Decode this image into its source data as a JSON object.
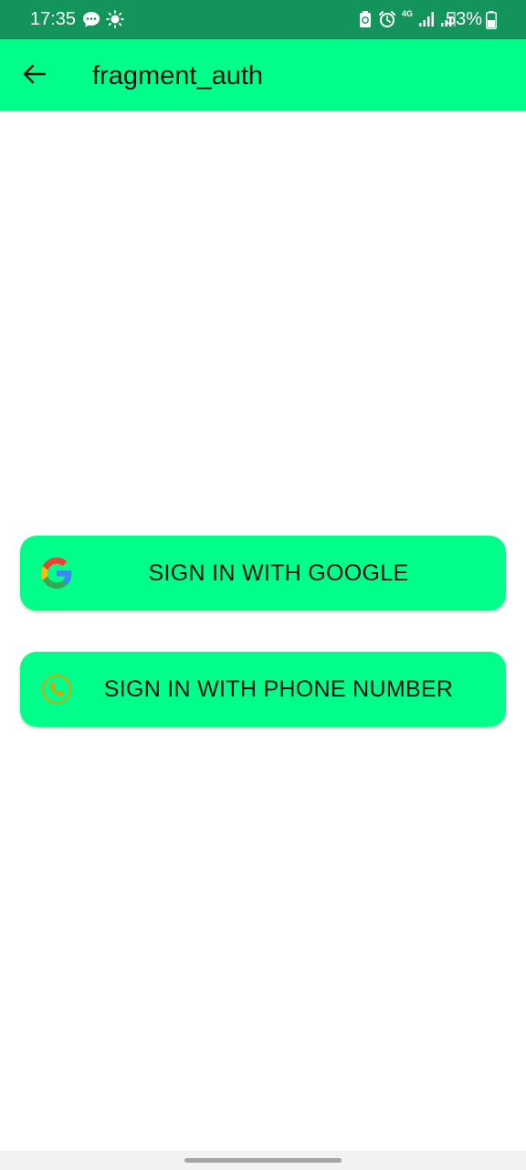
{
  "status_bar": {
    "time": "17:35",
    "battery_percent": "53%",
    "network": "4G",
    "left_icons": [
      "chat-icon",
      "brightness-icon"
    ],
    "right_icons": [
      "recycle-icon",
      "alarm-icon",
      "signal-icon",
      "signal-icon"
    ],
    "battery_level": 0.53
  },
  "app_bar": {
    "title": "fragment_auth",
    "back_icon": "arrow-left-icon",
    "color": "#00ff8a"
  },
  "buttons": {
    "google": {
      "label": "SIGN IN WITH GOOGLE",
      "icon": "google-icon"
    },
    "phone": {
      "label": "SIGN IN WITH PHONE NUMBER",
      "icon": "phone-icon"
    }
  },
  "colors": {
    "status_bar": "#13945b",
    "accent": "#00ff8a",
    "phone_icon": "#e0a000"
  }
}
